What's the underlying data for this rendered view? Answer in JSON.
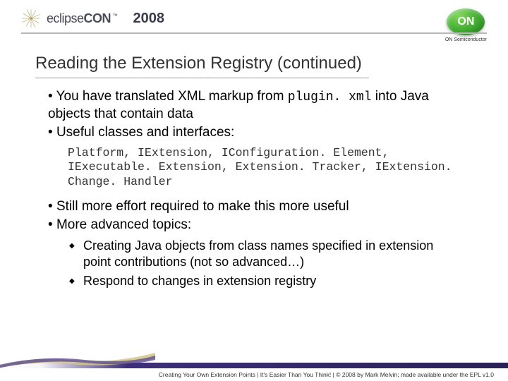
{
  "header": {
    "conference_name_light": "eclipse",
    "conference_name_bold": "CON",
    "tm": "™",
    "year": "2008",
    "sponsor_badge": "ON",
    "sponsor_name": "ON Semiconductor"
  },
  "slide": {
    "title": "Reading the Extension Registry (continued)",
    "bullets": [
      {
        "pre": "You have translated XML markup from ",
        "code": "plugin. xml",
        "post": " into Java objects that contain data"
      },
      {
        "text": "Useful classes and interfaces:"
      }
    ],
    "code_block": "Platform, IExtension, IConfiguration. Element, IExecutable. Extension, Extension. Tracker, IExtension. Change. Handler",
    "bullets2": [
      {
        "text": "Still more effort required to make this more useful"
      },
      {
        "text": "More advanced topics:"
      }
    ],
    "sub_bullets": [
      "Creating Java objects from class names specified in extension point contributions (not so advanced…)",
      "Respond to changes in extension registry"
    ]
  },
  "footer": {
    "text": "Creating Your Own Extension Points  |  It's Easier Than You Think!  |  © 2008 by Mark Melvin; made available under the EPL v1.0"
  }
}
